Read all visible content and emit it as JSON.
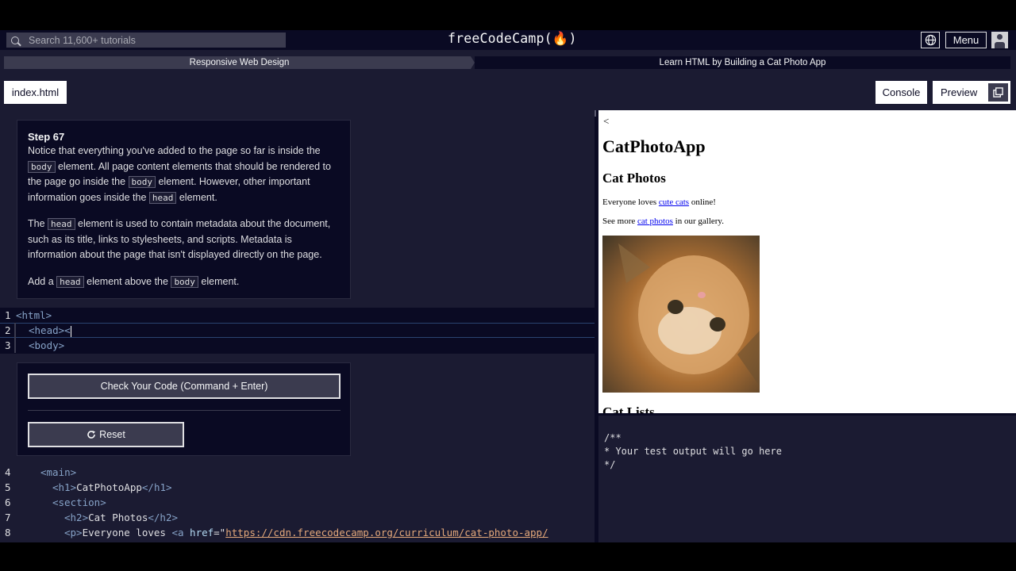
{
  "navbar": {
    "search_placeholder": "Search 11,600+ tutorials",
    "logo": "freeCodeCamp(🔥)",
    "menu_label": "Menu"
  },
  "breadcrumb": {
    "superblock": "Responsive Web Design",
    "block": "Learn HTML by Building a Cat Photo App"
  },
  "tabs": {
    "file": "index.html",
    "console": "Console",
    "preview": "Preview"
  },
  "description": {
    "step_title": "Step 67",
    "p1": {
      "a": "Notice that everything you've added to the page so far is inside the ",
      "code1": "body",
      "b": " element. All page content elements that should be rendered to the page go inside the ",
      "code2": "body",
      "c": " element. However, other important information goes inside the ",
      "code3": "head",
      "d": " element."
    },
    "p2": {
      "a": "The ",
      "code1": "head",
      "b": " element is used to contain metadata about the document, such as its title, links to stylesheets, and scripts. Metadata is information about the page that isn't displayed directly on the page."
    },
    "p3": {
      "a": "Add a ",
      "code1": "head",
      "b": " element above the ",
      "code2": "body",
      "c": " element."
    }
  },
  "editable_code": {
    "lines": [
      {
        "num": "1",
        "open": "<",
        "tag": "html",
        "close": ">"
      },
      {
        "num": "2",
        "text": "<head><"
      },
      {
        "num": "3",
        "text": "<body>"
      }
    ]
  },
  "actions": {
    "check_label": "Check Your Code (Command + Enter)",
    "reset_label": "Reset"
  },
  "code_below": {
    "l4_num": "4",
    "l4": "<main>",
    "l5_num": "5",
    "l5_tag_open": "<h1>",
    "l5_text": "CatPhotoApp",
    "l5_tag_close": "</h1>",
    "l6_num": "6",
    "l6": "<section>",
    "l7_num": "7",
    "l7_tag_open": "<h2>",
    "l7_text": "Cat Photos",
    "l7_tag_close": "</h2>",
    "l8_num": "8",
    "l8_tag_open": "<p>",
    "l8_text": "Everyone loves ",
    "l8_a": "<a ",
    "l8_attr": "href",
    "l8_eq": "=\"",
    "l8_url": "https://cdn.freecodecamp.org/curriculum/cat-photo-app/"
  },
  "preview": {
    "lt": "<",
    "h1": "CatPhotoApp",
    "h2": "Cat Photos",
    "p1_a": "Everyone loves ",
    "p1_link": "cute cats",
    "p1_b": " online!",
    "p2_a": "See more ",
    "p2_link": "cat photos",
    "p2_b": " in our gallery.",
    "h2b": "Cat Lists"
  },
  "console": {
    "line1": "/**",
    "line2": "* Your test output will go here",
    "line3": "*/"
  },
  "colors": {
    "bg_dark": "#0a0a23",
    "bg_mid": "#1b1b32",
    "bg_light": "#3b3b4f",
    "link": "#0000ee"
  }
}
